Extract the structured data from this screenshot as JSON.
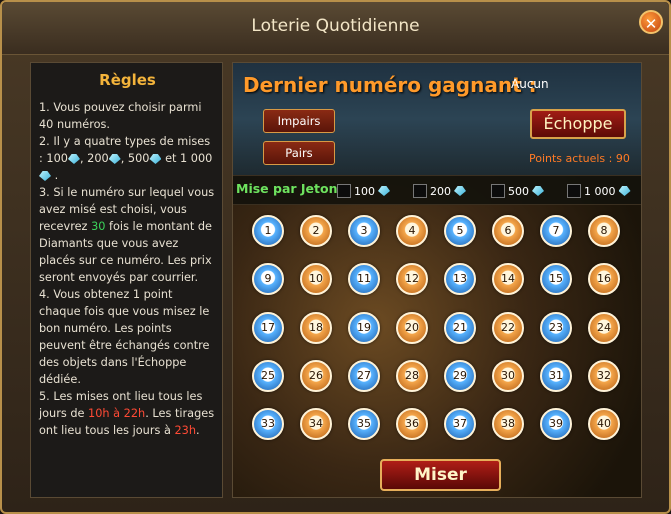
{
  "window": {
    "title": "Loterie Quotidienne",
    "close_label": "✕"
  },
  "rules": {
    "heading": "Règles",
    "r1": "1. Vous pouvez choisir parmi 40 numéros.",
    "r2_prefix": "2. Il y a quatre types de mises : 100",
    "r2_b": ", 200",
    "r2_c": ", 500",
    "r2_d": "et 1 000",
    "r2_end": ".",
    "r3_a": "3. Si le numéro sur lequel vous avez misé est choisi, vous recevrez",
    "r3_multiplier": "30",
    "r3_b": "fois le montant de Diamants que vous avez placés sur ce numéro. Les prix seront envoyés par courrier.",
    "r4": "4. Vous obtenez 1 point chaque fois que vous misez le bon numéro. Les points peuvent être échangés contre des objets dans l'Échoppe dédiée.",
    "r5_a": "5. Les mises ont lieu tous les jours de",
    "r5_time1": "10h à 22h",
    "r5_b": ". Les tirages ont lieu tous les jours à",
    "r5_time2": "23h",
    "r5_end": "."
  },
  "main": {
    "last_label": "Dernier numéro gagnant :",
    "last_value": "Aucun",
    "odd_label": "Impairs",
    "even_label": "Pairs",
    "shop_label": "Échoppe",
    "points_text": "Points actuels : 90",
    "stake_label": "Mise par Jeton",
    "stakes": [
      "100",
      "200",
      "500",
      "1 000"
    ],
    "bet_label": "Miser"
  },
  "balls": [
    "1",
    "2",
    "3",
    "4",
    "5",
    "6",
    "7",
    "8",
    "9",
    "10",
    "11",
    "12",
    "13",
    "14",
    "15",
    "16",
    "17",
    "18",
    "19",
    "20",
    "21",
    "22",
    "23",
    "24",
    "25",
    "26",
    "27",
    "28",
    "29",
    "30",
    "31",
    "32",
    "33",
    "34",
    "35",
    "36",
    "37",
    "38",
    "39",
    "40"
  ],
  "colors": {
    "blue_ball": "#3a85d6",
    "orange_ball": "#e08c2e",
    "accent": "#ff9a2a"
  }
}
